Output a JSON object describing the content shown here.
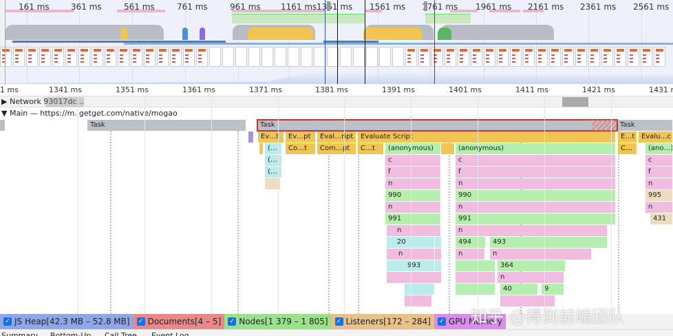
{
  "overview": {
    "ticks": [
      "161 ms",
      "361 ms",
      "561 ms",
      "761 ms",
      "961 ms",
      "1161 ms",
      "1361 ms",
      "1561 ms",
      "1761 ms",
      "1961 ms",
      "2161 ms",
      "2361 ms",
      "2561 ms"
    ]
  },
  "ruler": {
    "ticks": [
      "1 ms",
      "1341 ms",
      "1351 ms",
      "1361 ms",
      "1371 ms",
      "1381 ms",
      "1391 ms",
      "1401 ms",
      "1411 ms",
      "1421 ms",
      "1431 ms"
    ]
  },
  "tracks": {
    "network": "Network 93017dc…",
    "main": "Main — https://m.igetget.com/native/mogao"
  },
  "flame": [
    "Task",
    "Task",
    "Task",
    "Ev…t",
    "Ev…pt",
    "Eval…ript",
    "Evaluate Script",
    "E…t",
    "Evalu…c",
    "(…",
    "Co…t",
    "Com…pt",
    "C…t",
    "(anonymous)",
    "(anonymous)",
    "C…",
    "(ano…)",
    "(…",
    "c",
    "c",
    "c",
    "(…",
    "f",
    "f",
    "f",
    "n",
    "n",
    "n",
    "990",
    "990",
    "995",
    "n",
    "n",
    "n",
    "991",
    "991",
    "431",
    "n",
    "n",
    "20",
    "494",
    "493",
    "n",
    "n",
    "n",
    "993",
    "364",
    "n",
    "40",
    "9"
  ],
  "legend": [
    {
      "label": "JS Heap[42.3 MB – 52.8 MB]",
      "color": "#8fa7e6",
      "checked": true
    },
    {
      "label": "Documents[4 – 5]",
      "color": "#e88888",
      "checked": true
    },
    {
      "label": "Nodes[1 379 – 1 805]",
      "color": "#9be08a",
      "checked": true
    },
    {
      "label": "Listeners[172 – 284]",
      "color": "#e8c08a",
      "checked": true
    },
    {
      "label": "GPU Memory",
      "color": "#d88ee8",
      "checked": true
    }
  ],
  "bottom_tabs": [
    "Summary",
    "Bottom-Up",
    "Call Tree",
    "Event Log"
  ],
  "watermark": "知乎 @得到前端团队"
}
